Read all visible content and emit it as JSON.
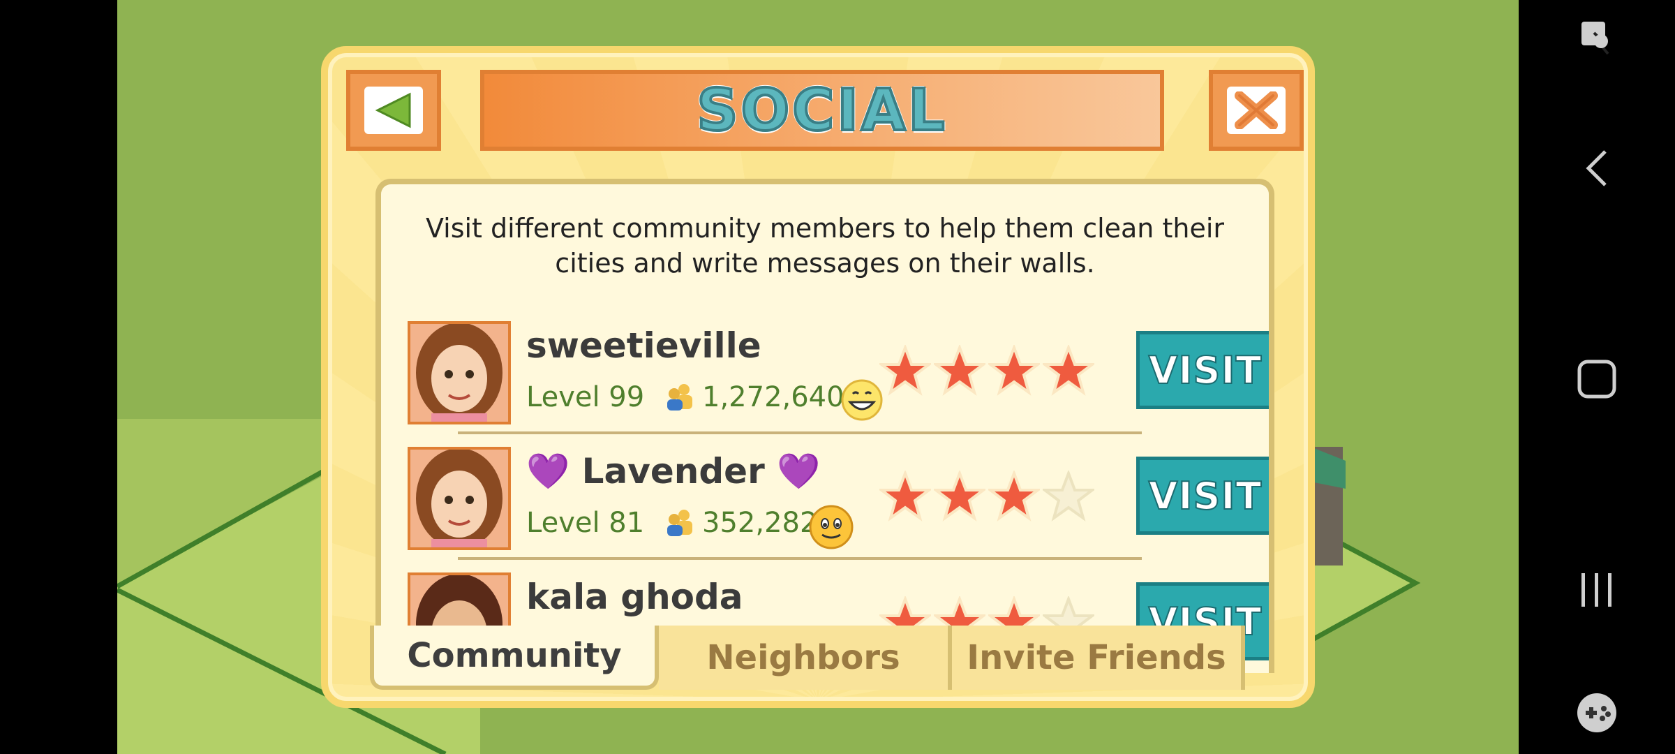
{
  "dialog": {
    "title": "SOCIAL",
    "description": "Visit different community members to help them clean their cities and write messages on their walls."
  },
  "members": [
    {
      "name": "sweetieville",
      "level": "Level 99",
      "population": "1,272,640",
      "stars": 4,
      "visit_label": "VISIT",
      "mood_icon": "grin-emoji-icon"
    },
    {
      "name": "💜 Lavender 💜",
      "level": "Level 81",
      "population": "352,282",
      "stars": 3,
      "visit_label": "VISIT",
      "mood_icon": "smile-emoji-icon"
    },
    {
      "name": "kala ghoda",
      "stars": 3,
      "visit_label": "VISIT"
    }
  ],
  "tabs": [
    {
      "label": "Community",
      "active": true
    },
    {
      "label": "Neighbors",
      "active": false
    },
    {
      "label": "Invite Friends",
      "active": false
    }
  ],
  "colors": {
    "accent_teal": "#2ba9ad",
    "title_orange": "#f28a3a",
    "star_red": "#ef5b3f",
    "level_green": "#4f7f2d"
  },
  "icons": {
    "back": "green-triangle-back-icon",
    "close": "orange-x-close-icon",
    "population": "people-icon"
  }
}
